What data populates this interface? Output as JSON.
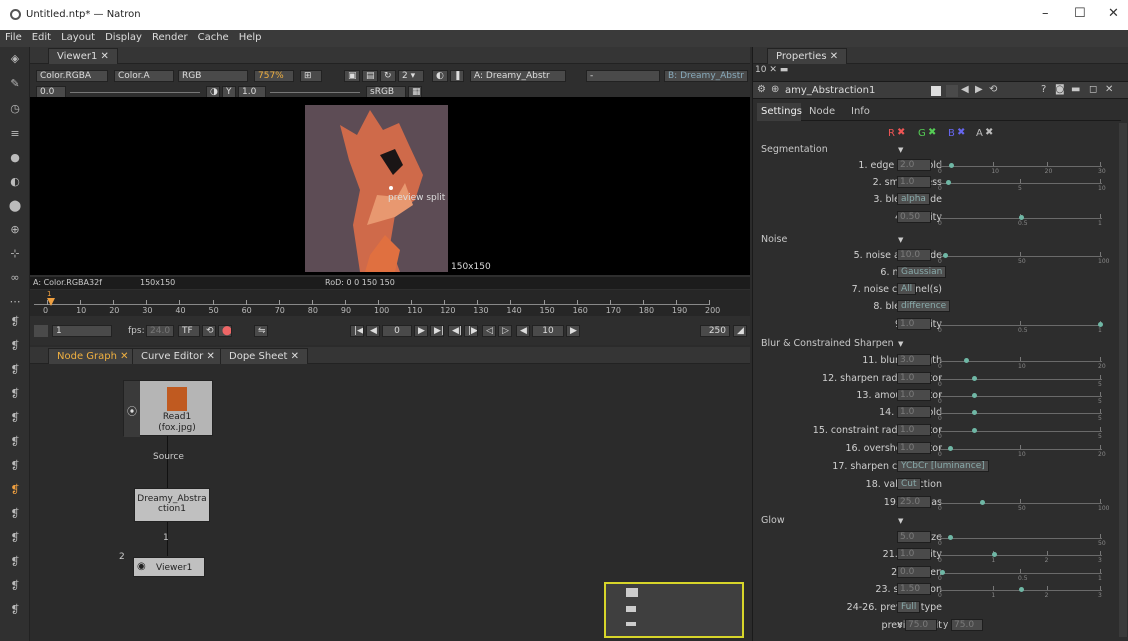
{
  "window": {
    "title": "Untitled.ntp* — Natron",
    "controls": [
      "–",
      "☐",
      "✕"
    ]
  },
  "menu": [
    "File",
    "Edit",
    "Layout",
    "Display",
    "Render",
    "Cache",
    "Help"
  ],
  "viewer": {
    "tab": "Viewer1",
    "layer": "Color.RGBA",
    "alpha_channel": "Color.A",
    "display_channels": "RGB",
    "zoom": "757%",
    "input_a": "A: Dreamy_Abstr",
    "input_b": "B: Dreamy_Abstr",
    "gain": "0.0",
    "gamma": "1.0",
    "colorspace": "sRGB",
    "gamma_label": "Y",
    "overlay_label": "preview split",
    "resolution_label": "150x150",
    "info_format": "A: Color.RGBA32f",
    "info_res": "150x150",
    "info_rod": "RoD: 0 0 150 150"
  },
  "timeline": {
    "ticks": [
      "0",
      "10",
      "20",
      "30",
      "40",
      "50",
      "60",
      "70",
      "80",
      "90",
      "100",
      "110",
      "120",
      "130",
      "140",
      "150",
      "160",
      "170",
      "180",
      "190",
      "200"
    ],
    "current_frame": "1",
    "fps_label": "fps:",
    "fps": "24.0",
    "tf_label": "TF",
    "play_frame": "0",
    "step": "10",
    "end_frame": "250",
    "cursor_label": "1"
  },
  "nodegraph": {
    "tabs": [
      "Node Graph",
      "Curve Editor",
      "Dope Sheet"
    ],
    "read_node": {
      "name": "Read1",
      "file": "(fox.jpg)"
    },
    "source_label": "Source",
    "dreamy_node": "Dreamy_Abstraction1",
    "dreamy_node_lines": [
      "Dreamy_Abstra",
      "ction1"
    ],
    "edge_label_1": "1",
    "edge_label_2": "2",
    "viewer_node": "Viewer1"
  },
  "properties": {
    "tab": "Properties",
    "max_panels": "10",
    "node_name": "amy_Abstraction1",
    "subtabs": [
      "Settings",
      "Node",
      "Info"
    ],
    "channels": [
      "R",
      "G",
      "B",
      "A"
    ],
    "sections": {
      "segmentation": "Segmentation",
      "noise": "Noise",
      "blur": "Blur & Constrained Sharpen",
      "glow": "Glow"
    },
    "params": [
      {
        "label": "1. edge threshold",
        "value": "2.0"
      },
      {
        "label": "2. smoothness",
        "value": "1.0"
      },
      {
        "label": "3. blend mode",
        "value": "alpha"
      },
      {
        "label": "4. opacity",
        "value": "0.50"
      },
      {
        "label": "5. noise amplitude",
        "value": "10.0"
      },
      {
        "label": "6. noise type",
        "value": "Gaussian"
      },
      {
        "label": "7. noise channel(s)",
        "value": "All"
      },
      {
        "label": "8. blend mode",
        "value": "difference"
      },
      {
        "label": "9. opacity",
        "value": "1.0"
      },
      {
        "label": "11. blur strength",
        "value": "3.0"
      },
      {
        "label": "12. sharpen radius factor",
        "value": "1.0"
      },
      {
        "label": "13. amount factor",
        "value": "1.0"
      },
      {
        "label": "14. threshold",
        "value": "1.0"
      },
      {
        "label": "15. constraint radius factor",
        "value": "1.0"
      },
      {
        "label": "16. overshoot factor",
        "value": "1.0"
      },
      {
        "label": "17. sharpen channel(s)",
        "value": "YCbCr [luminance]"
      },
      {
        "label": "18. value action",
        "value": "Cut"
      },
      {
        "label": "19. antialias",
        "value": "25.0"
      },
      {
        "label": "20. size",
        "value": "5.0"
      },
      {
        "label": "21. intensity",
        "value": "1.0"
      },
      {
        "label": "22. darken",
        "value": "0.0"
      },
      {
        "label": "23. saturation",
        "value": "1.50"
      },
      {
        "label": "24-26. preview type",
        "value": "Full"
      },
      {
        "label": "preview split",
        "x_label": "x",
        "x": "75.0",
        "y_label": "y",
        "y": "75.0"
      }
    ],
    "slider_ticks": {
      "s1": [
        "0",
        "10",
        "20",
        "30"
      ],
      "s2": [
        "0",
        "5",
        "10"
      ],
      "s4": [
        "0",
        "0.5",
        "1"
      ],
      "s5": [
        "0",
        "50",
        "100"
      ],
      "s11": [
        "0",
        "10",
        "20"
      ],
      "s12": [
        "0",
        "5"
      ],
      "s16": [
        "0",
        "10",
        "20"
      ],
      "s19": [
        "0",
        "50",
        "100"
      ],
      "s20": [
        "0",
        "50"
      ],
      "s21": [
        "0",
        "1",
        "2",
        "3"
      ],
      "s22": [
        "0",
        "0.5",
        "1"
      ]
    }
  },
  "colors": {
    "accent": "#f0b040",
    "slider_dot": "#6fb7a5",
    "minimap_border": "#d7d52a"
  }
}
